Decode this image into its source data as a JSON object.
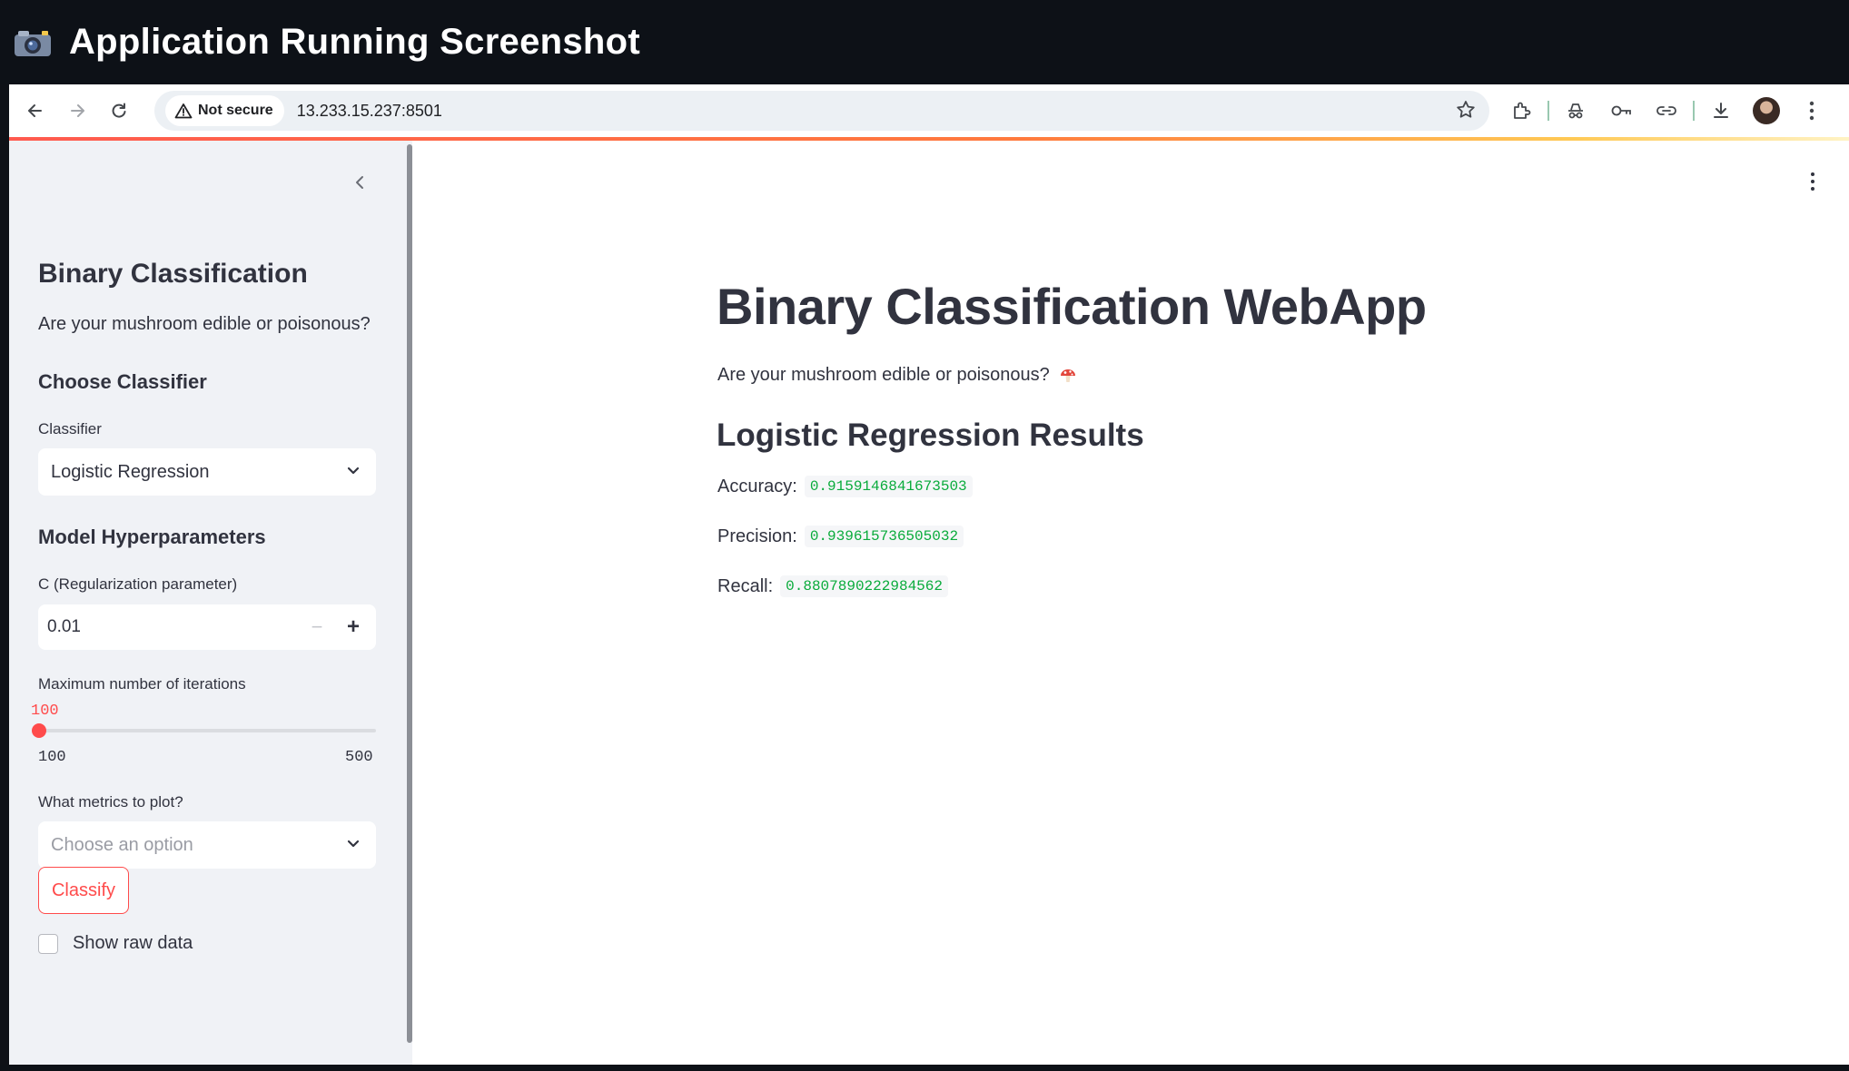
{
  "banner": {
    "icon": "camera-icon",
    "title": "Application Running Screenshot"
  },
  "browser": {
    "security_label": "Not secure",
    "url": "13.233.15.237:8501"
  },
  "sidebar": {
    "title": "Binary Classification",
    "subtitle": "Are your mushroom edible or poisonous?",
    "choose_classifier_heading": "Choose Classifier",
    "classifier_label": "Classifier",
    "classifier_value": "Logistic Regression",
    "hyperparams_heading": "Model Hyperparameters",
    "c_label": "C (Regularization parameter)",
    "c_value": "0.01",
    "minus_label": "−",
    "plus_label": "+",
    "max_iter_label": "Maximum number of iterations",
    "max_iter_value": "100",
    "max_iter_min": "100",
    "max_iter_max": "500",
    "metrics_label": "What metrics to plot?",
    "metrics_placeholder": "Choose an option",
    "classify_button": "Classify",
    "show_raw_label": "Show raw data"
  },
  "main": {
    "title": "Binary Classification WebApp",
    "subtitle": "Are your mushroom edible or poisonous?",
    "subtitle_icon": "mushroom-icon",
    "results_heading": "Logistic Regression Results",
    "metrics": [
      {
        "label": "Accuracy:",
        "value": "0.9159146841673503"
      },
      {
        "label": "Precision:",
        "value": "0.939615736505032"
      },
      {
        "label": "Recall:",
        "value": "0.8807890222984562"
      }
    ]
  },
  "colors": {
    "accent": "#ff4b4b",
    "code_green": "#09ab3b",
    "sidebar_bg": "#f0f2f6",
    "text": "#31333f"
  }
}
